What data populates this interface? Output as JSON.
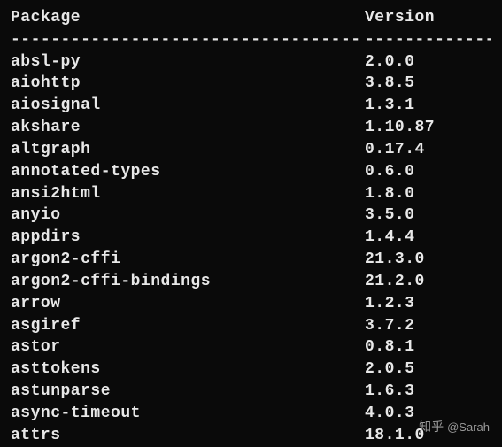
{
  "header": {
    "package_label": "Package",
    "version_label": "Version"
  },
  "divider": {
    "package_dashes": "-----------------------------------",
    "version_dashes": "-------------"
  },
  "rows": [
    {
      "package": "absl-py",
      "version": "2.0.0"
    },
    {
      "package": "aiohttp",
      "version": "3.8.5"
    },
    {
      "package": "aiosignal",
      "version": "1.3.1"
    },
    {
      "package": "akshare",
      "version": "1.10.87"
    },
    {
      "package": "altgraph",
      "version": "0.17.4"
    },
    {
      "package": "annotated-types",
      "version": "0.6.0"
    },
    {
      "package": "ansi2html",
      "version": "1.8.0"
    },
    {
      "package": "anyio",
      "version": "3.5.0"
    },
    {
      "package": "appdirs",
      "version": "1.4.4"
    },
    {
      "package": "argon2-cffi",
      "version": "21.3.0"
    },
    {
      "package": "argon2-cffi-bindings",
      "version": "21.2.0"
    },
    {
      "package": "arrow",
      "version": "1.2.3"
    },
    {
      "package": "asgiref",
      "version": "3.7.2"
    },
    {
      "package": "astor",
      "version": "0.8.1"
    },
    {
      "package": "asttokens",
      "version": "2.0.5"
    },
    {
      "package": "astunparse",
      "version": "1.6.3"
    },
    {
      "package": "async-timeout",
      "version": "4.0.3"
    },
    {
      "package": "attrs",
      "version": "18.1.0"
    }
  ],
  "watermark": {
    "logo": "知乎",
    "text": "@Sarah"
  }
}
